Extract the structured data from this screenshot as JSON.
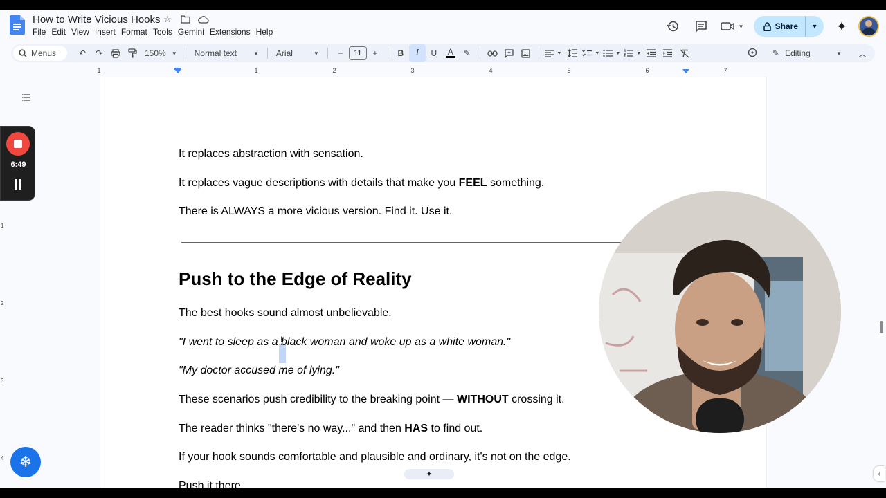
{
  "document": {
    "title": "How to Write Vicious Hooks"
  },
  "menu": [
    "File",
    "Edit",
    "View",
    "Insert",
    "Format",
    "Tools",
    "Gemini",
    "Extensions",
    "Help"
  ],
  "header": {
    "share_label": "Share"
  },
  "toolbar": {
    "search_label": "Menus",
    "zoom": "150%",
    "style": "Normal text",
    "font": "Arial",
    "font_size": "11",
    "mode": "Editing"
  },
  "ruler": {
    "labels": [
      "1",
      "1",
      "2",
      "3",
      "4",
      "5",
      "6",
      "7"
    ]
  },
  "vruler": {
    "labels": [
      "1",
      "2",
      "3",
      "4"
    ]
  },
  "recorder": {
    "time": "6:49"
  },
  "content": {
    "p1": "It replaces abstraction with sensation.",
    "p2_pre": "It replaces vague descriptions with details that make you ",
    "p2_bold": "FEEL",
    "p2_post": " something.",
    "p3": "There is ALWAYS a more vicious version. Find it. Use it.",
    "heading": "Push to the Edge of Reality",
    "p4": "The best hooks sound almost unbelievable.",
    "q1_pre": "\"I went to sleep as ",
    "q1_sel": "a",
    "q1_post": " black woman and woke up as a white woman.\"",
    "q2": "\"My doctor accused me of lying.\"",
    "p5_pre": "These scenarios push credibility to the breaking point — ",
    "p5_bold": "WITHOUT",
    "p5_post": " crossing it.",
    "p6_pre": "The reader thinks \"there's no way...\" and then ",
    "p6_bold": "HAS",
    "p6_post": " to find out.",
    "p7": "If your hook sounds comfortable and plausible and ordinary, it's not on the edge.",
    "p8": "Push it there."
  },
  "colors": {
    "accent": "#c2e7ff",
    "recorder_red": "#f0483e",
    "selection": "#c2d7f7"
  }
}
